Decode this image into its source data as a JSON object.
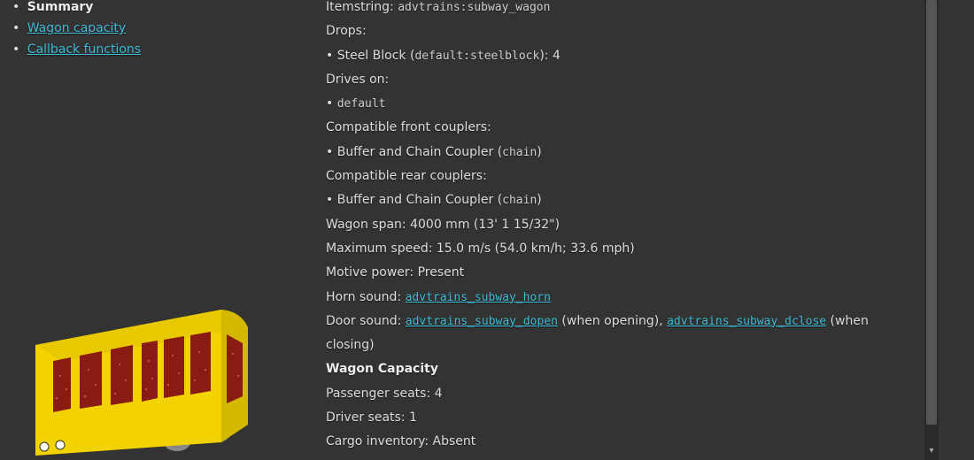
{
  "sidebar": {
    "items": [
      {
        "label": "Summary",
        "active": true
      },
      {
        "label": "Wagon capacity",
        "active": false
      },
      {
        "label": "Callback functions",
        "active": false
      }
    ]
  },
  "summary": {
    "itemstring_label": "Itemstring: ",
    "itemstring_value": "advtrains:subway_wagon",
    "drops_label": "Drops:",
    "drop_item_prefix": "• Steel Block (",
    "drop_item_code": "default:steelblock",
    "drop_item_suffix": "): 4",
    "drives_on_label": "Drives on:",
    "drives_on_item_prefix": "• ",
    "drives_on_item": "default",
    "front_couplers_label": "Compatible front couplers:",
    "front_coupler_text": "• Buffer and Chain Coupler (",
    "front_coupler_code": "chain",
    "front_coupler_suffix": ")",
    "rear_couplers_label": "Compatible rear couplers:",
    "rear_coupler_text": "• Buffer and Chain Coupler (",
    "rear_coupler_code": "chain",
    "rear_coupler_suffix": ")",
    "span": "Wagon span: 4000 mm (13' 1 15/32\")",
    "max_speed": "Maximum speed: 15.0 m/s (54.0 km/h; 33.6 mph)",
    "motive_power": "Motive power: Present",
    "horn_sound_label": "Horn sound: ",
    "horn_sound_link": "advtrains_subway_horn",
    "door_sound_label": "Door sound: ",
    "door_open_link": "advtrains_subway_dopen",
    "door_open_suffix": " (when opening), ",
    "door_close_link": "advtrains_subway_dclose",
    "door_close_suffix": " (when closing)"
  },
  "capacity": {
    "heading": "Wagon Capacity",
    "passenger": "Passenger seats: 4",
    "driver": "Driver seats: 1",
    "cargo": "Cargo inventory: Absent"
  }
}
